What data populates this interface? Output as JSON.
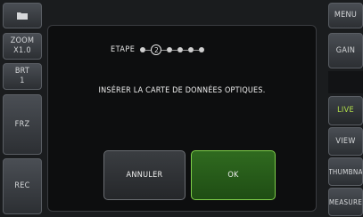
{
  "left": {
    "folder_icon": "folder-icon",
    "zoom": "ZOOM\nX1.0",
    "brt": "BRT\n1",
    "frz": "FRZ",
    "rec": "REC"
  },
  "right": {
    "menu": "MENU",
    "gain": "GAIN",
    "live": "LIVE",
    "view": "VIEW",
    "thumbnail": "THUMBNA",
    "measure": "MEASURE"
  },
  "dialog": {
    "step_label": "ETAPE",
    "current_step": "2",
    "message": "INSÉRER LA CARTE DE DONNÉES OPTIQUES.",
    "cancel_label": "ANNULER",
    "ok_label": "OK"
  },
  "colors": {
    "active": "#b4e24a",
    "ok_border": "#7fcf4a"
  }
}
